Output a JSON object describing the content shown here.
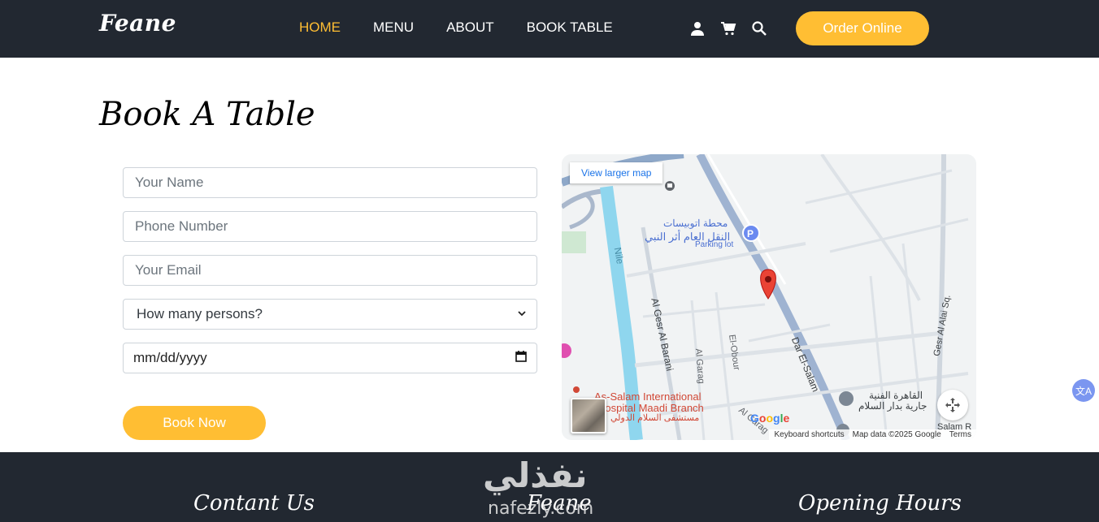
{
  "header": {
    "logo": "Feane",
    "nav": [
      {
        "label": "HOME",
        "active": true
      },
      {
        "label": "MENU",
        "active": false
      },
      {
        "label": "ABOUT",
        "active": false
      },
      {
        "label": "BOOK TABLE",
        "active": false
      }
    ],
    "icons": [
      "user-icon",
      "cart-icon",
      "search-icon"
    ],
    "order_label": "Order Online"
  },
  "page_title": "Book A Table",
  "form": {
    "name_placeholder": "Your Name",
    "phone_placeholder": "Phone Number",
    "email_placeholder": "Your Email",
    "persons_selected": "How many persons?",
    "date_placeholder": "mm/dd/yyyy",
    "submit_label": "Book Now"
  },
  "map": {
    "larger_map_label": "View larger map",
    "labels": {
      "bus_station_ar_1": "محطة اتوبيسات",
      "bus_station_ar_2": "النقل العام أثر النبي",
      "parking": "Parking lot",
      "nile": "Nile",
      "gesr_barani": "Al Gesr Al Barani",
      "garag": "Al Garag",
      "el_obour": "El-Obour",
      "dar_el_salam": "Dar El-Salam",
      "gesr_alai": "Gesr Al Alai Sq.",
      "hospital_1": "As-Salam International",
      "hospital_2": "Hospital Maadi Branch",
      "hospital_ar": "مستشفى السلام الدولي",
      "school_ar_1": "القاهرة الفنية",
      "school_ar_2": "جارية بدار السلام",
      "salam_r": "Salam R",
      "al_garag_bottom": "Al Garag"
    },
    "google_logo": "Google",
    "footer": [
      "Keyboard shortcuts",
      "Map data ©2025 Google",
      "Terms"
    ]
  },
  "translate_label": "文A",
  "footer": {
    "headings": [
      "Contant Us",
      "Feane",
      "Opening Hours"
    ]
  },
  "watermark": {
    "text": "نفذلي",
    "url": "nafezly.com"
  },
  "colors": {
    "accent": "#ffbe33",
    "dark": "#222831"
  }
}
